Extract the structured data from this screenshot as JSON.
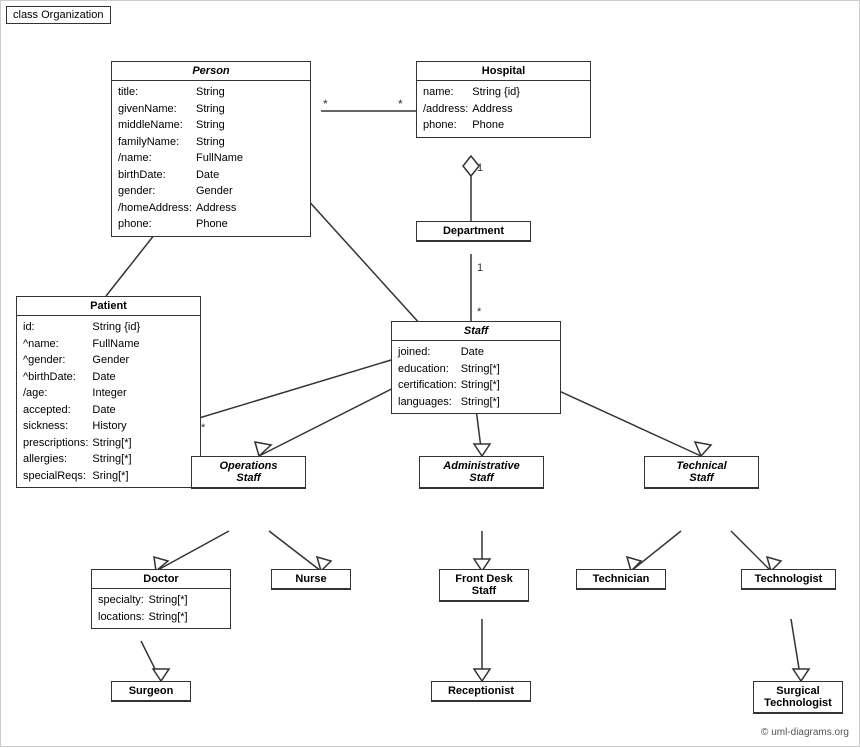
{
  "diagram": {
    "title": "class Organization",
    "classes": {
      "person": {
        "title": "Person",
        "italic": true,
        "attributes": [
          {
            "name": "title:",
            "type": "String"
          },
          {
            "name": "givenName:",
            "type": "String"
          },
          {
            "name": "middleName:",
            "type": "String"
          },
          {
            "name": "familyName:",
            "type": "String"
          },
          {
            "name": "/name:",
            "type": "FullName"
          },
          {
            "name": "birthDate:",
            "type": "Date"
          },
          {
            "name": "gender:",
            "type": "Gender"
          },
          {
            "name": "/homeAddress:",
            "type": "Address"
          },
          {
            "name": "phone:",
            "type": "Phone"
          }
        ]
      },
      "hospital": {
        "title": "Hospital",
        "italic": false,
        "attributes": [
          {
            "name": "name:",
            "type": "String {id}"
          },
          {
            "name": "/address:",
            "type": "Address"
          },
          {
            "name": "phone:",
            "type": "Phone"
          }
        ]
      },
      "department": {
        "title": "Department",
        "italic": false,
        "attributes": []
      },
      "patient": {
        "title": "Patient",
        "italic": false,
        "attributes": [
          {
            "name": "id:",
            "type": "String {id}"
          },
          {
            "name": "^name:",
            "type": "FullName"
          },
          {
            "name": "^gender:",
            "type": "Gender"
          },
          {
            "name": "^birthDate:",
            "type": "Date"
          },
          {
            "name": "/age:",
            "type": "Integer"
          },
          {
            "name": "accepted:",
            "type": "Date"
          },
          {
            "name": "sickness:",
            "type": "History"
          },
          {
            "name": "prescriptions:",
            "type": "String[*]"
          },
          {
            "name": "allergies:",
            "type": "String[*]"
          },
          {
            "name": "specialReqs:",
            "type": "Sring[*]"
          }
        ]
      },
      "staff": {
        "title": "Staff",
        "italic": true,
        "attributes": [
          {
            "name": "joined:",
            "type": "Date"
          },
          {
            "name": "education:",
            "type": "String[*]"
          },
          {
            "name": "certification:",
            "type": "String[*]"
          },
          {
            "name": "languages:",
            "type": "String[*]"
          }
        ]
      },
      "operations_staff": {
        "title": "Operations\nStaff",
        "italic": true
      },
      "administrative_staff": {
        "title": "Administrative\nStaff",
        "italic": true
      },
      "technical_staff": {
        "title": "Technical\nStaff",
        "italic": true
      },
      "doctor": {
        "title": "Doctor",
        "italic": false,
        "attributes": [
          {
            "name": "specialty:",
            "type": "String[*]"
          },
          {
            "name": "locations:",
            "type": "String[*]"
          }
        ]
      },
      "nurse": {
        "title": "Nurse",
        "italic": false,
        "attributes": []
      },
      "front_desk_staff": {
        "title": "Front Desk\nStaff",
        "italic": false,
        "attributes": []
      },
      "technician": {
        "title": "Technician",
        "italic": false,
        "attributes": []
      },
      "technologist": {
        "title": "Technologist",
        "italic": false,
        "attributes": []
      },
      "surgeon": {
        "title": "Surgeon",
        "italic": false,
        "attributes": []
      },
      "receptionist": {
        "title": "Receptionist",
        "italic": false,
        "attributes": []
      },
      "surgical_technologist": {
        "title": "Surgical\nTechnologist",
        "italic": false,
        "attributes": []
      }
    },
    "copyright": "© uml-diagrams.org"
  }
}
